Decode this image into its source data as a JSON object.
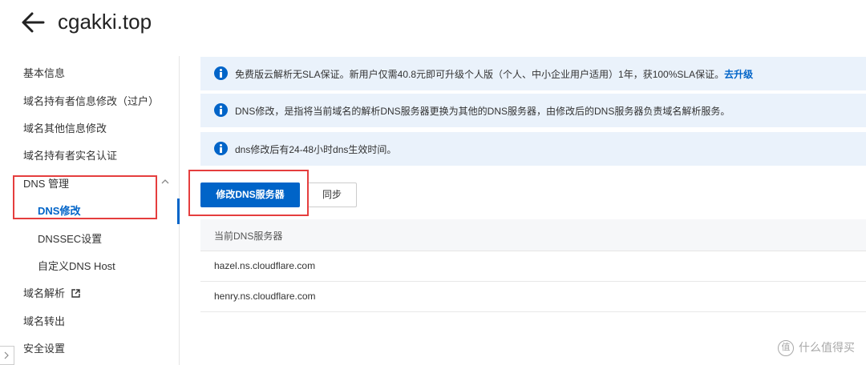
{
  "header": {
    "title": "cgakki.top"
  },
  "sidebar": {
    "items": [
      {
        "label": "基本信息"
      },
      {
        "label": "域名持有者信息修改（过户）"
      },
      {
        "label": "域名其他信息修改"
      },
      {
        "label": "域名持有者实名认证"
      },
      {
        "label": "DNS 管理"
      },
      {
        "label": "DNS修改"
      },
      {
        "label": "DNSSEC设置"
      },
      {
        "label": "自定义DNS Host"
      },
      {
        "label": "域名解析"
      },
      {
        "label": "域名转出"
      },
      {
        "label": "安全设置"
      }
    ]
  },
  "notices": [
    {
      "text": "免费版云解析无SLA保证。新用户仅需40.8元即可升级个人版（个人、中小企业用户适用）1年，获100%SLA保证。",
      "link": "去升级"
    },
    {
      "text": "DNS修改，是指将当前域名的解析DNS服务器更换为其他的DNS服务器，由修改后的DNS服务器负责域名解析服务。"
    },
    {
      "text": "dns修改后有24-48小时dns生效时间。"
    }
  ],
  "actions": {
    "modify_label": "修改DNS服务器",
    "sync_label": "同步"
  },
  "dns_table": {
    "header": "当前DNS服务器",
    "rows": [
      "hazel.ns.cloudflare.com",
      "henry.ns.cloudflare.com"
    ]
  },
  "watermark": {
    "badge": "值",
    "text": "什么值得买"
  },
  "colors": {
    "accent": "#0064c8",
    "highlight": "#e53e3e",
    "notice_bg": "#eaf2fb"
  }
}
